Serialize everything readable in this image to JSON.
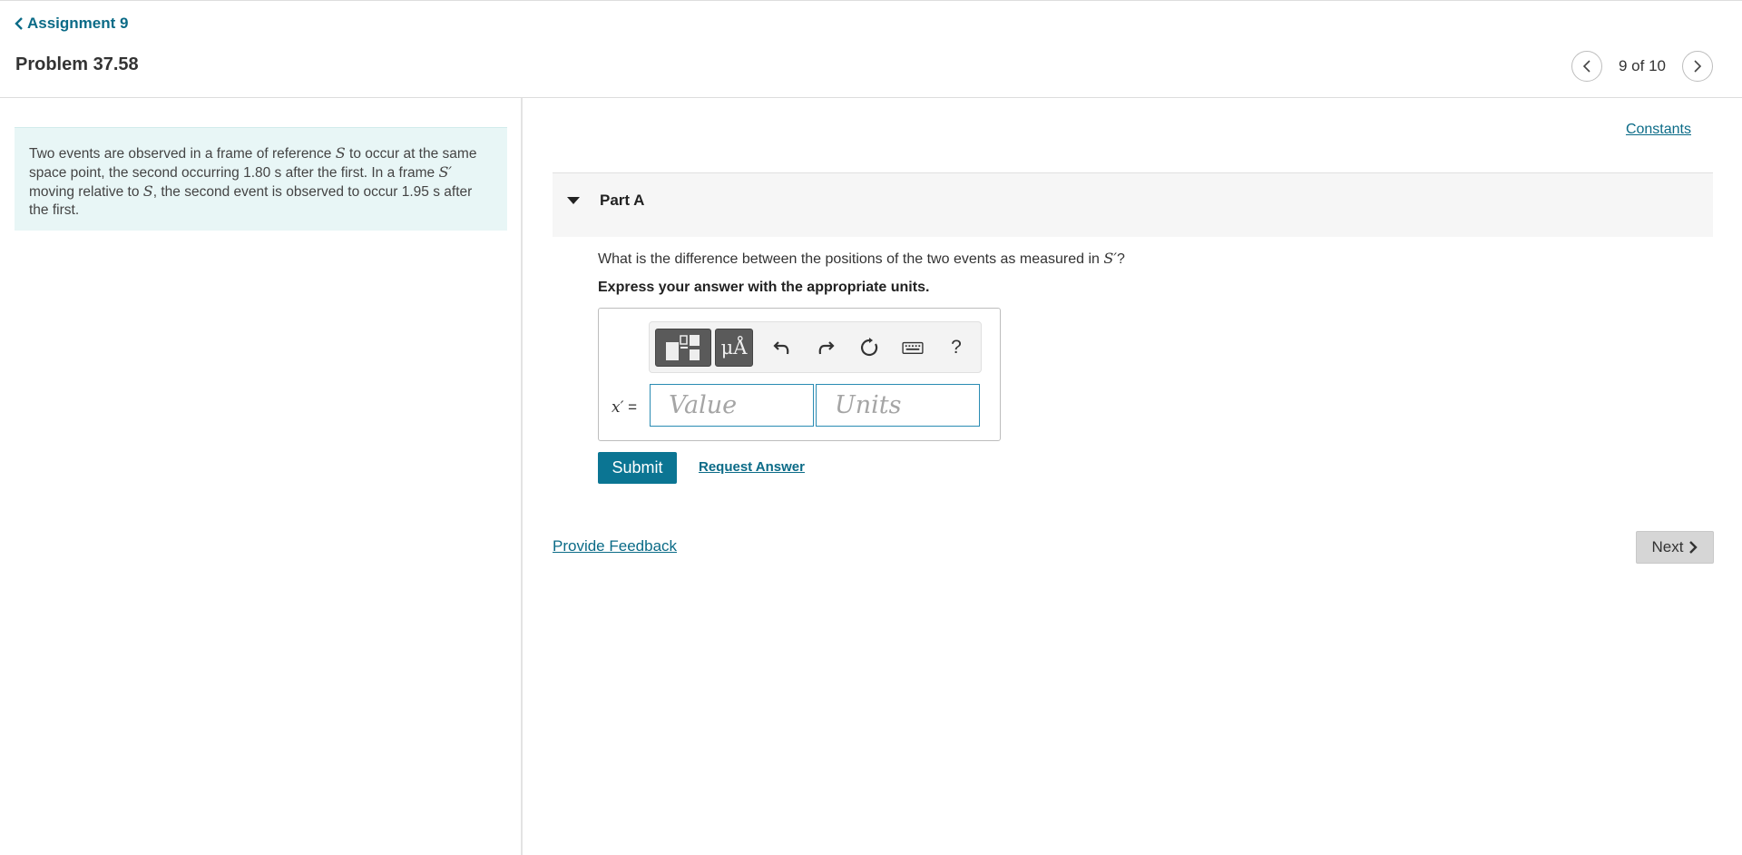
{
  "header": {
    "back_label": "Assignment 9",
    "problem_title": "Problem 37.58",
    "pager_text": "9 of 10"
  },
  "intro": {
    "t1": "Two events are observed in a frame of reference ",
    "S1": "S",
    "t2": " to occur at the same space point, the second occurring 1.80  s after the first. In a frame ",
    "Sp": "S′",
    "t3": " moving relative to ",
    "S2": "S",
    "t4": ", the second event is observed to occur 1.95  s after the first."
  },
  "right": {
    "constants_label": "Constants",
    "part_title": "Part A",
    "question_pre": "What is the difference between the positions of the two events as measured in ",
    "question_sym": "S′",
    "question_post": "?",
    "instruction": "Express your answer with the appropriate units."
  },
  "answer": {
    "variable": "x′",
    "equals": " =",
    "value_placeholder": "Value",
    "units_placeholder": "Units",
    "units_button": "μÅ",
    "help_button": "?"
  },
  "actions": {
    "submit_label": "Submit",
    "request_label": "Request Answer",
    "feedback_label": "Provide Feedback",
    "next_label": "Next"
  },
  "colors": {
    "link": "#0b6b87",
    "submit_bg": "#0b7593",
    "intro_bg": "#e8f6f6",
    "input_border": "#2a8bb3"
  }
}
